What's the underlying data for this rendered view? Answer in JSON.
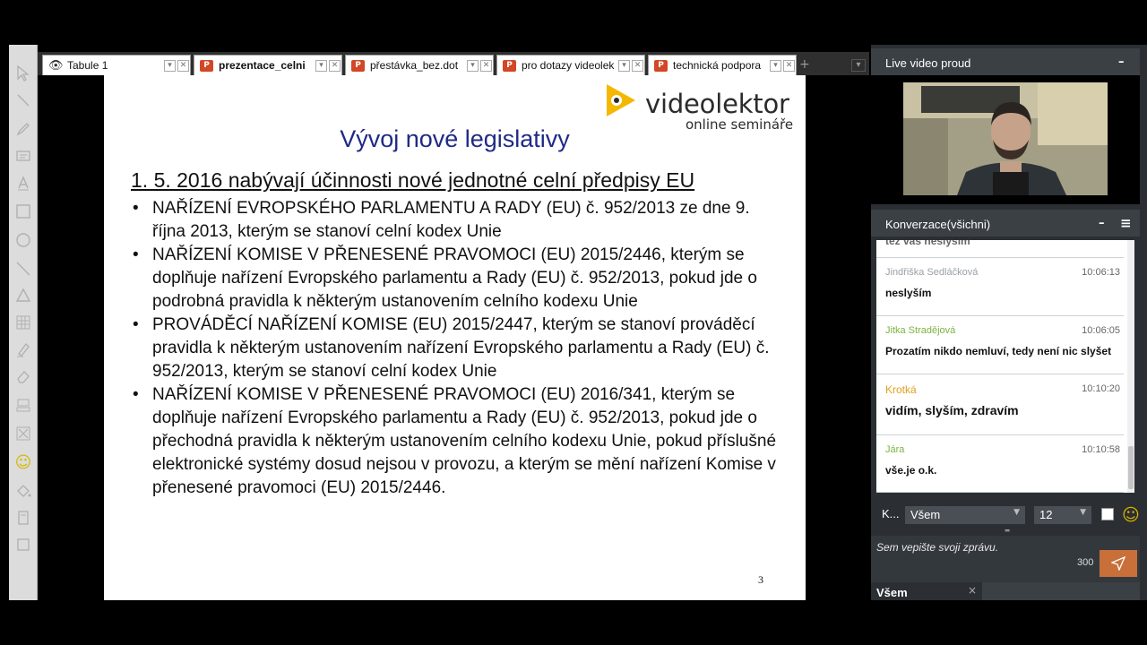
{
  "tabs": [
    {
      "label": "Tabule 1",
      "icon": "eye-icon"
    },
    {
      "label": "prezentace_celni",
      "icon": "powerpoint-icon"
    },
    {
      "label": "přestávka_bez.dot",
      "icon": "powerpoint-icon"
    },
    {
      "label": "pro dotazy videolek",
      "icon": "powerpoint-icon"
    },
    {
      "label": "technická podpora",
      "icon": "powerpoint-icon"
    }
  ],
  "tab_icon_letter": "P",
  "tab_add_symbol": "+",
  "slide": {
    "logo_text": "videolektor",
    "logo_subtitle": "online semináře",
    "title": "Vývoj nové legislativy",
    "heading": "1. 5. 2016 nabývají účinnosti nové jednotné celní předpisy EU",
    "bullets": [
      "NAŘÍZENÍ EVROPSKÉHO PARLAMENTU A RADY (EU) č. 952/2013 ze dne 9. října 2013, kterým se stanoví celní kodex Unie",
      "NAŘÍZENÍ KOMISE V PŘENESENÉ PRAVOMOCI (EU) 2015/2446, kterým se doplňuje nařízení Evropského parlamentu a Rady (EU) č. 952/2013, pokud jde o podrobná pravidla k některým ustanovením celního kodexu Unie",
      "PROVÁDĚCÍ NAŘÍZENÍ KOMISE (EU) 2015/2447, kterým se stanoví prováděcí pravidla k některým ustanovením nařízení Evropského parlamentu a Rady (EU) č. 952/2013, kterým se stanoví celní kodex Unie",
      "NAŘÍZENÍ KOMISE V PŘENESENÉ PRAVOMOCI (EU) 2016/341, kterým se doplňuje nařízení Evropského parlamentu a Rady (EU) č. 952/2013, pokud jde o přechodná pravidla k některým ustanovením celního kodexu Unie, pokud příslušné elektronické systémy dosud nejsou v provozu, a kterým se mění nařízení Komise v přenesené pravomoci (EU) 2015/2446."
    ],
    "page_number": "3"
  },
  "video_panel": {
    "title": "Live video proud",
    "minimize_symbol": "–"
  },
  "chat_panel": {
    "title": "Konverzace(všichni)",
    "minimize_symbol": "–",
    "menu_symbol": "≡",
    "partial_message": "tež vás neslyším",
    "messages": [
      {
        "name": "Jindřiška Sedláčková",
        "time": "10:06:13",
        "text": "neslyším",
        "name_color": "#9aa0a6"
      },
      {
        "name": "Jitka Stradějová",
        "time": "10:06:05",
        "text": "Prozatím nikdo nemluví, tedy není nic slyšet",
        "name_color": "#7cb342"
      },
      {
        "name": "Krotká",
        "time": "10:10:20",
        "text": "vidím, slyším, zdravím",
        "name_color": "#e0a020"
      },
      {
        "name": "Jára",
        "time": "10:10:58",
        "text": "vše.je o.k.",
        "name_color": "#7cb342"
      }
    ]
  },
  "chat_controls": {
    "to_label": "K...",
    "recipient": "Všem",
    "font_size": "12",
    "compose_placeholder": "Sem vepište svoji zprávu.",
    "char_count": "300",
    "bottom_tab": "Všem",
    "bottom_close": "×"
  },
  "colors": {
    "accent": "#c86f3a",
    "slide_title": "#1f2a86",
    "logo_yellow": "#f5b800"
  }
}
